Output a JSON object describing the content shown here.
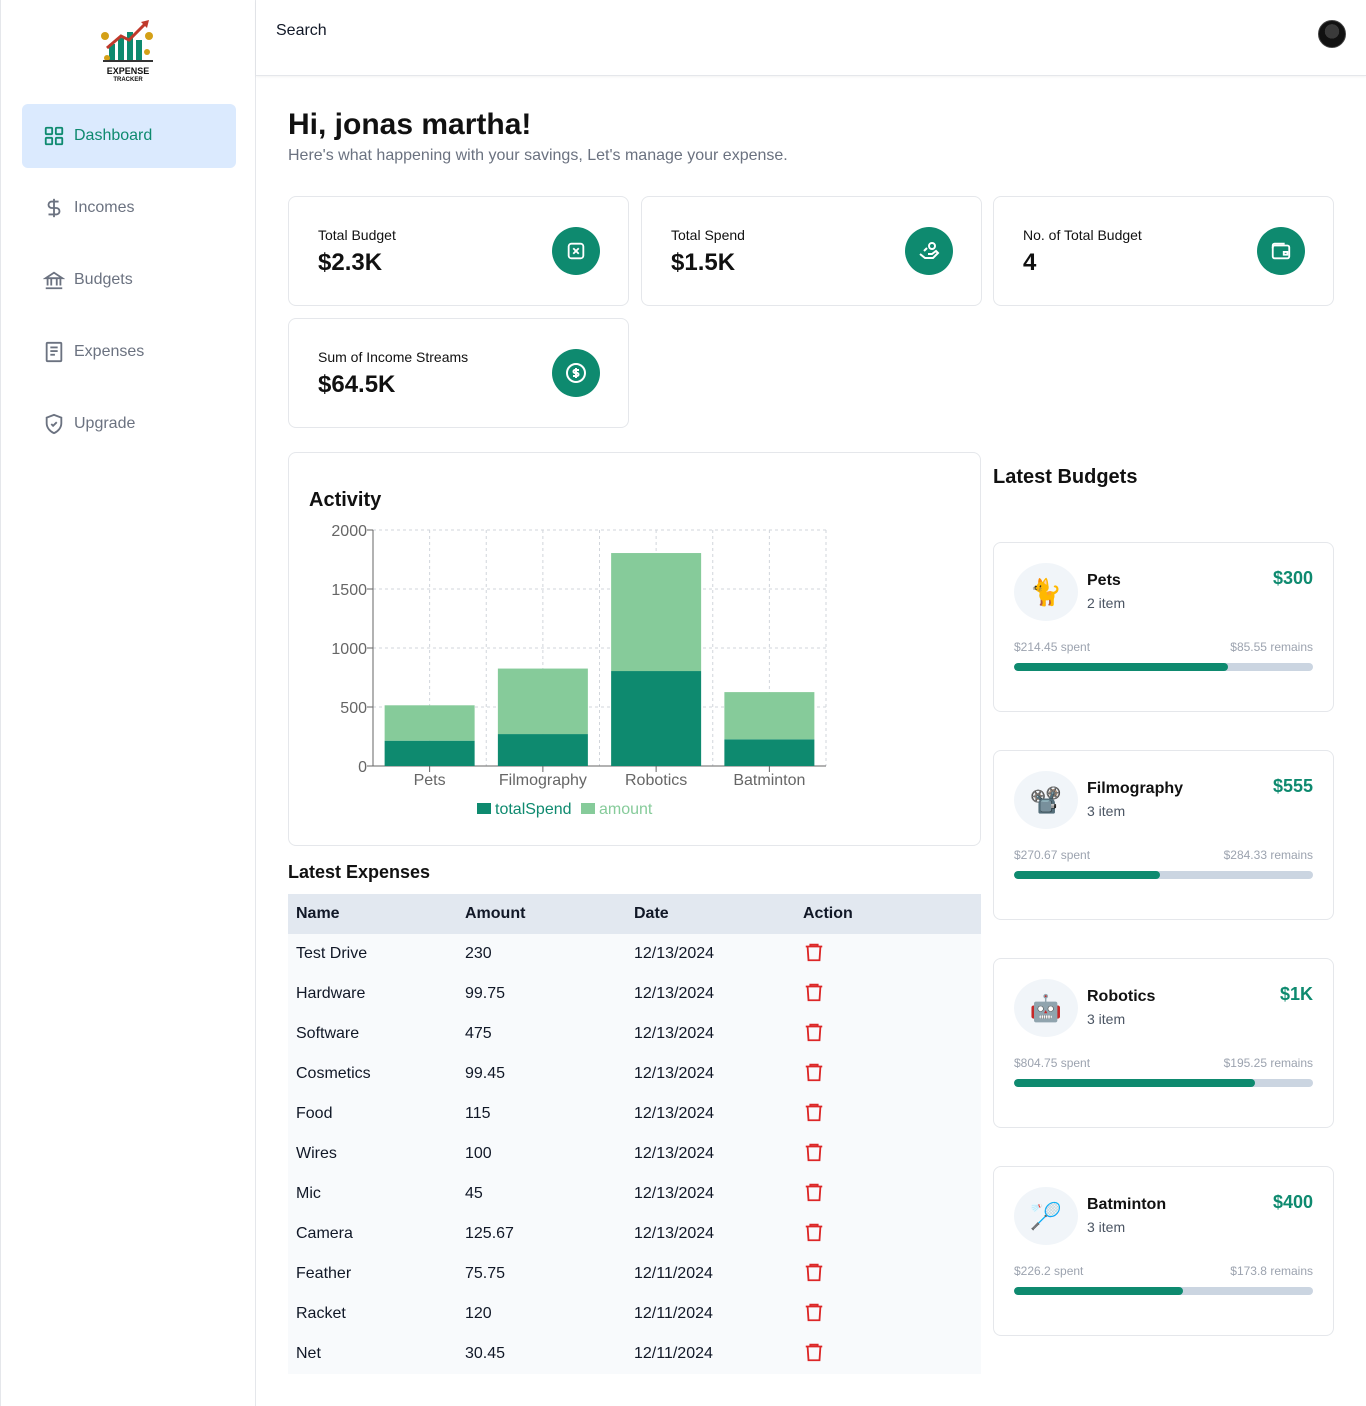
{
  "brand": {
    "logo_line1": "EXPENSE",
    "logo_line2": "TRACKER"
  },
  "sidebar": {
    "items": [
      {
        "label": "Dashboard",
        "icon": "layout-grid-icon",
        "active": true
      },
      {
        "label": "Incomes",
        "icon": "dollar-sign-icon",
        "active": false
      },
      {
        "label": "Budgets",
        "icon": "bank-icon",
        "active": false
      },
      {
        "label": "Expenses",
        "icon": "receipt-icon",
        "active": false
      },
      {
        "label": "Upgrade",
        "icon": "shield-check-icon",
        "active": false
      }
    ]
  },
  "header": {
    "search_label": "Search"
  },
  "main": {
    "greeting": "Hi, jonas martha!",
    "subtitle": "Here's what happening with your savings, Let's manage your expense."
  },
  "stats": [
    {
      "label": "Total Budget",
      "value": "$2.3K",
      "icon": "piggy-bank-icon"
    },
    {
      "label": "Total Spend",
      "value": "$1.5K",
      "icon": "hand-coins-icon"
    },
    {
      "label": "No. of Total Budget",
      "value": "4",
      "icon": "wallet-icon"
    },
    {
      "label": "Sum of Income Streams",
      "value": "$64.5K",
      "icon": "circle-dollar-icon"
    }
  ],
  "activity": {
    "title": "Activity"
  },
  "chart_data": {
    "type": "bar",
    "stacked": true,
    "categories": [
      "Pets",
      "Filmography",
      "Robotics",
      "Batminton"
    ],
    "series": [
      {
        "name": "totalSpend",
        "values": [
          214.45,
          270.67,
          804.75,
          226.2
        ],
        "color": "#0e8a6f"
      },
      {
        "name": "amount",
        "values": [
          300,
          555,
          1000,
          400
        ],
        "color": "#86cb9a"
      }
    ],
    "ylim": [
      0,
      2000
    ],
    "yticks": [
      "0",
      "500",
      "1000",
      "1500",
      "2000"
    ],
    "grid": true,
    "legend": "bottom"
  },
  "latest_expenses": {
    "title": "Latest Expenses",
    "headers": [
      "Name",
      "Amount",
      "Date",
      "Action"
    ],
    "rows": [
      {
        "name": "Test Drive",
        "amount": "230",
        "date": "12/13/2024"
      },
      {
        "name": "Hardware",
        "amount": "99.75",
        "date": "12/13/2024"
      },
      {
        "name": "Software",
        "amount": "475",
        "date": "12/13/2024"
      },
      {
        "name": "Cosmetics",
        "amount": "99.45",
        "date": "12/13/2024"
      },
      {
        "name": "Food",
        "amount": "115",
        "date": "12/13/2024"
      },
      {
        "name": "Wires",
        "amount": "100",
        "date": "12/13/2024"
      },
      {
        "name": "Mic",
        "amount": "45",
        "date": "12/13/2024"
      },
      {
        "name": "Camera",
        "amount": "125.67",
        "date": "12/13/2024"
      },
      {
        "name": "Feather",
        "amount": "75.75",
        "date": "12/11/2024"
      },
      {
        "name": "Racket",
        "amount": "120",
        "date": "12/11/2024"
      },
      {
        "name": "Net",
        "amount": "30.45",
        "date": "12/11/2024"
      }
    ]
  },
  "latest_budgets": {
    "title": "Latest Budgets",
    "items": [
      {
        "emoji": "🐈",
        "name": "Pets",
        "count": "2 item",
        "amount": "$300",
        "spent": "$214.45 spent",
        "remains": "$85.55 remains",
        "progress": 0.715
      },
      {
        "emoji": "📽️",
        "name": "Filmography",
        "count": "3 item",
        "amount": "$555",
        "spent": "$270.67 spent",
        "remains": "$284.33 remains",
        "progress": 0.488
      },
      {
        "emoji": "🤖",
        "name": "Robotics",
        "count": "3 item",
        "amount": "$1K",
        "spent": "$804.75 spent",
        "remains": "$195.25 remains",
        "progress": 0.805
      },
      {
        "emoji": "🏸",
        "name": "Batminton",
        "count": "3 item",
        "amount": "$400",
        "spent": "$226.2 spent",
        "remains": "$173.8 remains",
        "progress": 0.566
      }
    ]
  }
}
